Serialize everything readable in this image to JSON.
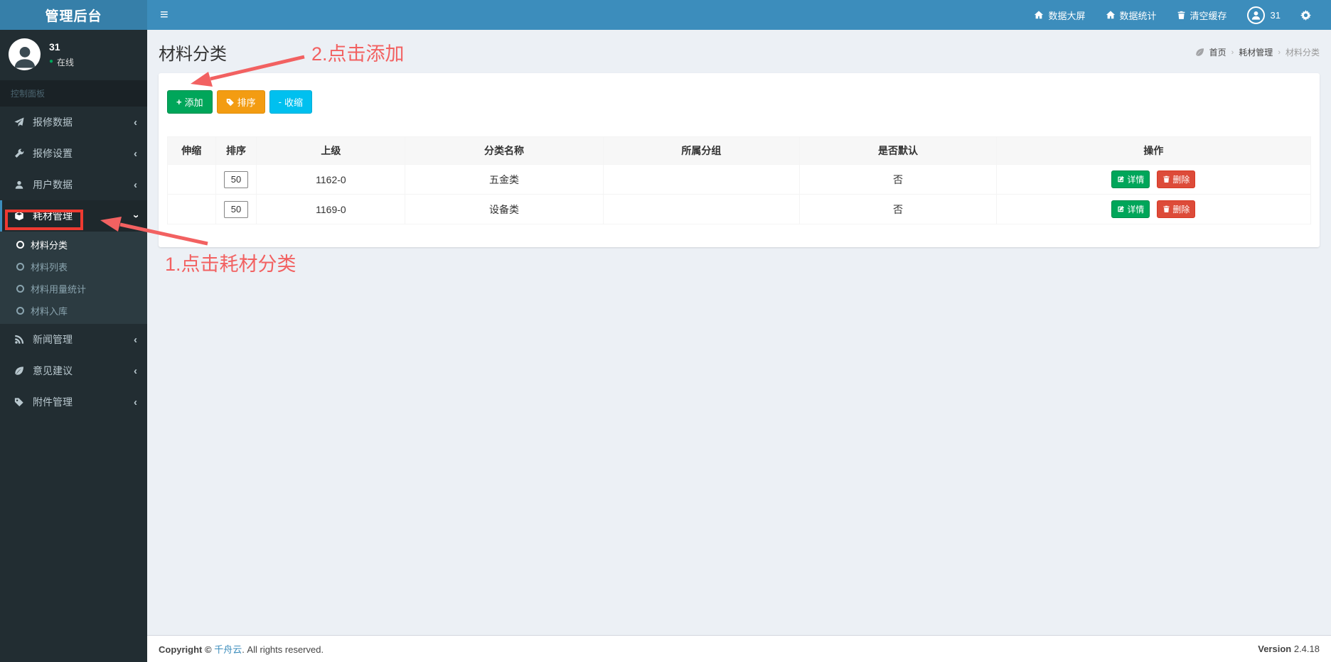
{
  "navbar": {
    "brand": "管理后台",
    "links": [
      {
        "icon": "home-icon",
        "label": "数据大屏"
      },
      {
        "icon": "home-icon",
        "label": "数据统计"
      },
      {
        "icon": "trash-icon",
        "label": "清空缓存"
      }
    ],
    "username": "31"
  },
  "sidebar": {
    "user": {
      "name": "31",
      "status": "在线"
    },
    "section_label": "控制面板",
    "items": [
      {
        "icon": "paper-plane-icon",
        "label": "报修数据"
      },
      {
        "icon": "wrench-icon",
        "label": "报修设置"
      },
      {
        "icon": "user-icon",
        "label": "用户数据"
      },
      {
        "icon": "cube-icon",
        "label": "耗材管理",
        "children": [
          {
            "label": "材料分类"
          },
          {
            "label": "材料列表"
          },
          {
            "label": "材料用量统计"
          },
          {
            "label": "材料入库"
          }
        ]
      },
      {
        "icon": "rss-icon",
        "label": "新闻管理"
      },
      {
        "icon": "leaf-icon",
        "label": "意见建议"
      },
      {
        "icon": "tag-icon",
        "label": "附件管理"
      }
    ]
  },
  "page": {
    "title": "材料分类",
    "breadcrumb": {
      "home": "首页",
      "section": "耗材管理",
      "current": "材料分类"
    }
  },
  "toolbar": {
    "add": "添加",
    "sort": "排序",
    "collapse": "收缩",
    "add_prefix": "+",
    "collapse_prefix": "-"
  },
  "table": {
    "headers": [
      "伸缩",
      "排序",
      "上级",
      "分类名称",
      "所属分组",
      "是否默认",
      "操作"
    ],
    "rows": [
      {
        "stretch": "",
        "sort": "50",
        "parent": "1162-0",
        "name": "五金类",
        "group": "",
        "is_default": "否"
      },
      {
        "stretch": "",
        "sort": "50",
        "parent": "1169-0",
        "name": "设备类",
        "group": "",
        "is_default": "否"
      }
    ],
    "actions": {
      "detail": "详情",
      "delete": "删除"
    }
  },
  "annotations": {
    "step1": "1.点击耗材分类",
    "step2": "2.点击添加"
  },
  "footer": {
    "copyright_prefix": "Copyright © ",
    "company": "千舟云",
    "copyright_suffix": ". All rights reserved.",
    "version_label": "Version",
    "version": "2.4.18"
  },
  "icons": {
    "hamburger": "≡",
    "chevron": "‹",
    "status_dot": "●",
    "sep": "›"
  },
  "colors": {
    "navbar": "#3c8dbc",
    "brand_bg": "#367fa9",
    "sidebar": "#222d32",
    "submenu": "#2c3b41",
    "success": "#00a65a",
    "warning": "#f39c12",
    "info": "#00c0ef",
    "danger": "#dd4b39",
    "annotation_red": "#f26161",
    "highlight_box_red": "#ee3a31",
    "content_bg": "#ecf0f5"
  }
}
